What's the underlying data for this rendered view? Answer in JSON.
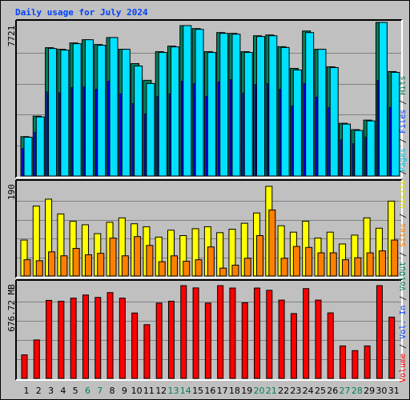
{
  "chart_data": [
    {
      "type": "bar",
      "panel": "hits-files-pages",
      "title": "Daily usage for July 2024",
      "ylabel": "7721",
      "ylim": [
        0,
        7721
      ],
      "grid": true,
      "categories": [
        "1",
        "2",
        "3",
        "4",
        "5",
        "6",
        "7",
        "8",
        "9",
        "10",
        "11",
        "12",
        "13",
        "14",
        "15",
        "16",
        "17",
        "18",
        "19",
        "20",
        "21",
        "22",
        "23",
        "24",
        "25",
        "26",
        "27",
        "28",
        "29",
        "30",
        "31"
      ],
      "weekend_days": [
        "6",
        "7",
        "13",
        "14",
        "20",
        "21",
        "27",
        "28"
      ],
      "series": [
        {
          "name": "Hits",
          "color": "#00805c",
          "values": [
            1980,
            3010,
            6450,
            6370,
            6690,
            6850,
            6610,
            6960,
            6370,
            5650,
            4810,
            6250,
            6530,
            7560,
            7410,
            6250,
            7210,
            7170,
            6250,
            7050,
            7090,
            6500,
            5410,
            7290,
            6370,
            5490,
            2650,
            2330,
            2810,
            7720,
            5250
          ]
        },
        {
          "name": "Files",
          "color": "#00e0ff",
          "values": [
            1950,
            2970,
            6410,
            6330,
            6650,
            6850,
            6570,
            6960,
            6370,
            5530,
            4650,
            6210,
            6490,
            7560,
            7370,
            6210,
            7170,
            7130,
            6210,
            7010,
            7050,
            6460,
            5330,
            7210,
            6370,
            5450,
            2610,
            2290,
            2770,
            7720,
            5210
          ]
        },
        {
          "name": "Pages",
          "color": "#0000ff",
          "values": [
            1390,
            2210,
            4230,
            4190,
            4450,
            4490,
            4370,
            4770,
            4130,
            3650,
            3130,
            4010,
            4130,
            4770,
            4650,
            4010,
            4730,
            4850,
            4170,
            4610,
            4650,
            4370,
            3530,
            4650,
            3970,
            3450,
            1830,
            1630,
            1970,
            4810,
            3450
          ]
        }
      ]
    },
    {
      "type": "bar",
      "panel": "visits-sites",
      "ylabel": "190",
      "ylim": [
        0,
        190
      ],
      "grid": true,
      "categories": [
        "1",
        "2",
        "3",
        "4",
        "5",
        "6",
        "7",
        "8",
        "9",
        "10",
        "11",
        "12",
        "13",
        "14",
        "15",
        "16",
        "17",
        "18",
        "19",
        "20",
        "21",
        "22",
        "23",
        "24",
        "25",
        "26",
        "27",
        "28",
        "29",
        "30",
        "31"
      ],
      "series": [
        {
          "name": "Visits",
          "color": "#ffff00",
          "values": [
            73,
            142,
            156,
            126,
            111,
            104,
            86,
            109,
            118,
            106,
            100,
            79,
            93,
            82,
            96,
            100,
            88,
            95,
            107,
            128,
            182,
            102,
            89,
            111,
            77,
            89,
            65,
            83,
            118,
            97,
            152
          ]
        },
        {
          "name": "Sites",
          "color": "#ff8000",
          "values": [
            33,
            31,
            49,
            41,
            56,
            43,
            46,
            77,
            41,
            80,
            62,
            29,
            41,
            30,
            33,
            59,
            16,
            22,
            36,
            82,
            134,
            36,
            60,
            58,
            47,
            47,
            33,
            37,
            47,
            51,
            73
          ]
        }
      ]
    },
    {
      "type": "bar",
      "panel": "volume",
      "ylabel": "676.72 MB",
      "ylim": [
        0,
        676.72
      ],
      "grid": true,
      "categories": [
        "1",
        "2",
        "3",
        "4",
        "5",
        "6",
        "7",
        "8",
        "9",
        "10",
        "11",
        "12",
        "13",
        "14",
        "15",
        "16",
        "17",
        "18",
        "19",
        "20",
        "21",
        "22",
        "23",
        "24",
        "25",
        "26",
        "27",
        "28",
        "29",
        "30",
        "31"
      ],
      "series": [
        {
          "name": "Volume",
          "color": "#ff0000",
          "values": [
            166,
            271,
            550,
            544,
            566,
            588,
            571,
            605,
            566,
            461,
            379,
            531,
            544,
            654,
            638,
            531,
            654,
            637,
            533,
            637,
            621,
            552,
            457,
            633,
            552,
            462,
            229,
            196,
            229,
            654,
            432
          ]
        }
      ]
    }
  ],
  "title": "Daily usage for July 2024",
  "side_labels": {
    "top": [
      {
        "text": "Pages",
        "color": "#00c0e0"
      },
      {
        "text": " / ",
        "color": "#000000"
      },
      {
        "text": "Files",
        "color": "#0040ff"
      },
      {
        "text": " / ",
        "color": "#000000"
      },
      {
        "text": "Hits",
        "color": "#00805c"
      }
    ],
    "middle": [
      {
        "text": "Out",
        "color": "#00805c"
      },
      {
        "text": " / ",
        "color": "#000000"
      },
      {
        "text": "Sites",
        "color": "#ff8000"
      },
      {
        "text": " / ",
        "color": "#000000"
      },
      {
        "text": "Visits",
        "color": "#e0e000"
      },
      {
        "text": " / ",
        "color": "#000000"
      }
    ],
    "bottom": [
      {
        "text": "Volume",
        "color": "#ff0000"
      },
      {
        "text": " / ",
        "color": "#000000"
      },
      {
        "text": "Vol. In",
        "color": "#0040ff"
      },
      {
        "text": " / ",
        "color": "#000000"
      },
      {
        "text": "Vol. ",
        "color": "#00805c"
      }
    ]
  },
  "colors": {
    "background": "#c0c0c0",
    "grid": "#808080",
    "weekday_label": "#000000",
    "weekend_label": "#00805c"
  }
}
